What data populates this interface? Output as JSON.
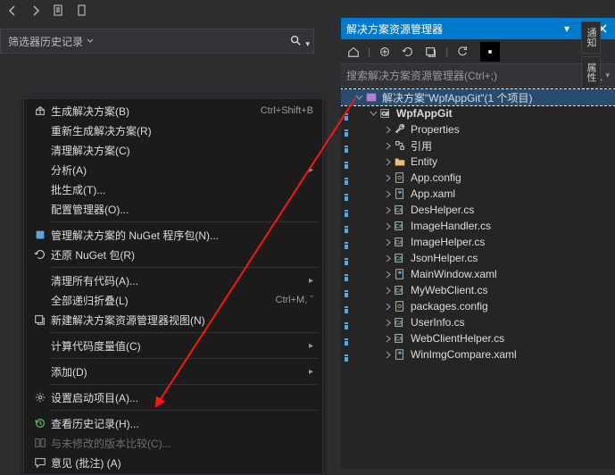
{
  "top_left": {
    "filter_label": "筛选器历史记录"
  },
  "context_menu": [
    {
      "icon": "build",
      "label": "生成解决方案(B)",
      "shortcut": "Ctrl+Shift+B"
    },
    {
      "label": "重新生成解决方案(R)"
    },
    {
      "label": "清理解决方案(C)"
    },
    {
      "label": "分析(A)",
      "sub": true
    },
    {
      "label": "批生成(T)..."
    },
    {
      "label": "配置管理器(O)..."
    },
    {
      "sep": true
    },
    {
      "icon": "nuget",
      "label": "管理解决方案的 NuGet 程序包(N)..."
    },
    {
      "icon": "restore",
      "label": "还原 NuGet 包(R)"
    },
    {
      "sep": true
    },
    {
      "label": "清理所有代码(A)...",
      "sub": true
    },
    {
      "label": "全部递归折叠(L)",
      "shortcut": "Ctrl+M, ˇ"
    },
    {
      "icon": "newview",
      "label": "新建解决方案资源管理器视图(N)"
    },
    {
      "sep": true
    },
    {
      "label": "计算代码度量值(C)",
      "sub": true
    },
    {
      "sep": true
    },
    {
      "label": "添加(D)",
      "sub": true
    },
    {
      "sep": true
    },
    {
      "icon": "gear",
      "label": "设置启动项目(A)..."
    },
    {
      "sep": true
    },
    {
      "icon": "history",
      "label": "查看历史记录(H)..."
    },
    {
      "icon": "compare",
      "label": "与未修改的版本比较(C)...",
      "disabled": true
    },
    {
      "icon": "comment",
      "label": "意见 (批注) (A)"
    }
  ],
  "panel": {
    "title": "解决方案资源管理器",
    "search_placeholder": "搜索解决方案资源管理器(Ctrl+;)",
    "solution_label": "解决方案\"WpfAppGit\"(1 个项目)",
    "project": "WpfAppGit",
    "children": [
      {
        "icon": "wrench",
        "label": "Properties",
        "exp": "closed"
      },
      {
        "icon": "ref",
        "label": "引用",
        "exp": "closed"
      },
      {
        "icon": "folder",
        "label": "Entity",
        "exp": "closed"
      },
      {
        "icon": "config",
        "label": "App.config",
        "exp": "closed"
      },
      {
        "icon": "xaml",
        "label": "App.xaml",
        "exp": "closed"
      },
      {
        "icon": "cs",
        "label": "DesHelper.cs",
        "exp": "closed"
      },
      {
        "icon": "cs",
        "label": "ImageHandler.cs",
        "exp": "closed"
      },
      {
        "icon": "cs",
        "label": "ImageHelper.cs",
        "exp": "closed"
      },
      {
        "icon": "cs",
        "label": "JsonHelper.cs",
        "exp": "closed"
      },
      {
        "icon": "xaml",
        "label": "MainWindow.xaml",
        "exp": "closed"
      },
      {
        "icon": "cs",
        "label": "MyWebClient.cs",
        "exp": "closed"
      },
      {
        "icon": "config",
        "label": "packages.config",
        "exp": "closed"
      },
      {
        "icon": "cs",
        "label": "UserInfo.cs",
        "exp": "closed"
      },
      {
        "icon": "cs",
        "label": "WebClientHelper.cs",
        "exp": "closed"
      },
      {
        "icon": "xaml",
        "label": "WinImgCompare.xaml",
        "exp": "closed"
      }
    ]
  },
  "side_tabs": [
    "通知",
    "属性"
  ]
}
